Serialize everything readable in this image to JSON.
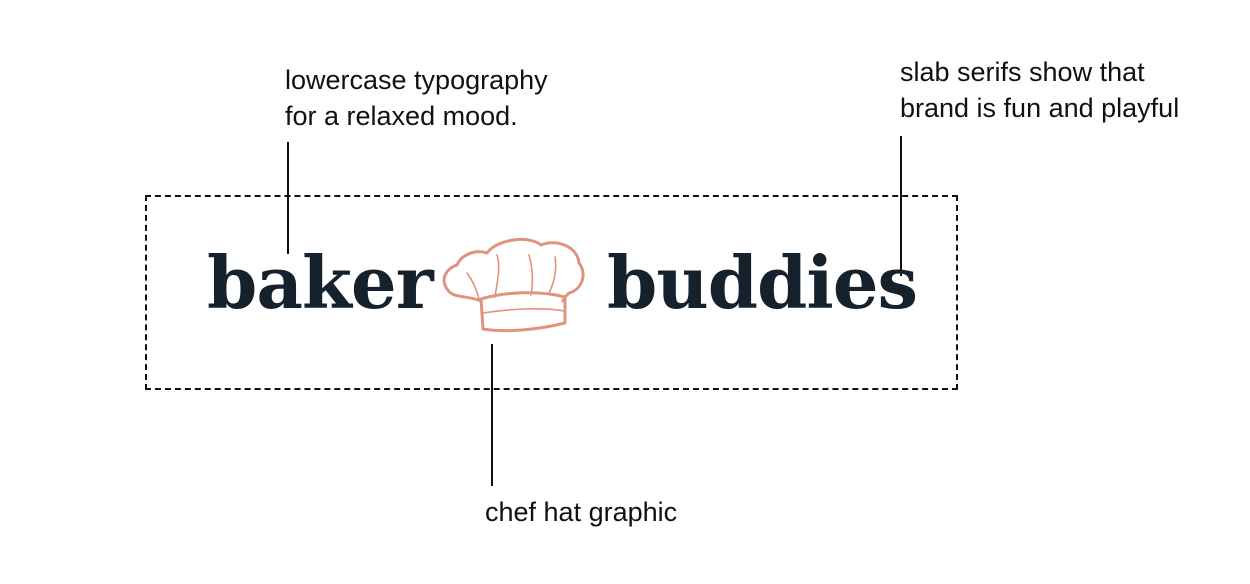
{
  "annotations": {
    "typography": {
      "line1": "lowercase typography",
      "line2": "for a relaxed mood."
    },
    "serifs": {
      "line1": "slab serifs show that",
      "line2": "brand is fun and playful"
    },
    "hat": {
      "text": "chef hat graphic"
    }
  },
  "logo": {
    "word_left": "baker",
    "word_right": "buddies",
    "icon": "chef-hat-icon",
    "text_color": "#15222e",
    "icon_color": "#e0937f"
  }
}
